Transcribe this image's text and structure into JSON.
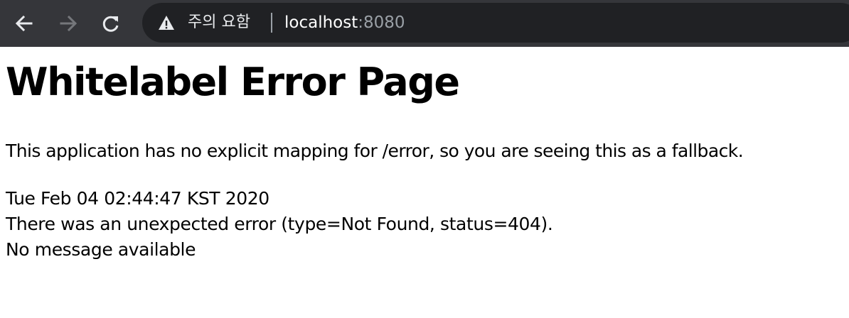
{
  "browser": {
    "security_label": "주의 요함",
    "url_host": "localhost",
    "url_port": ":8080"
  },
  "page": {
    "title": "Whitelabel Error Page",
    "fallback_message": "This application has no explicit mapping for /error, so you are seeing this as a fallback.",
    "timestamp": "Tue Feb 04 02:44:47 KST 2020",
    "error_line": "There was an unexpected error (type=Not Found, status=404).",
    "message_line": "No message available"
  },
  "colors": {
    "toolbar_bg": "#35363a",
    "omnibox_bg": "#202124",
    "page_text": "#000000"
  }
}
